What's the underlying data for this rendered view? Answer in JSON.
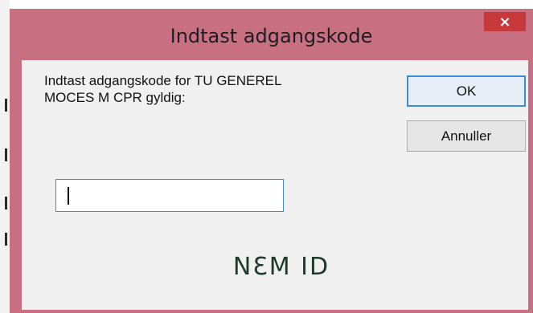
{
  "window": {
    "title": "Indtast adgangskode",
    "close_label": "×"
  },
  "dialog": {
    "prompt_line1": "Indtast adgangskode for TU GENEREL",
    "prompt_line2": "MOCES M CPR gyldig:",
    "ok_label": "OK",
    "cancel_label": "Annuller",
    "password_value": "",
    "logo_text": "NƐM ID"
  },
  "colors": {
    "titlebar": "#c86f82",
    "close_button": "#c7393a",
    "client_bg": "#f0f0f0",
    "focus_border": "#3c8cd8",
    "logo": "#1d3b2c"
  }
}
